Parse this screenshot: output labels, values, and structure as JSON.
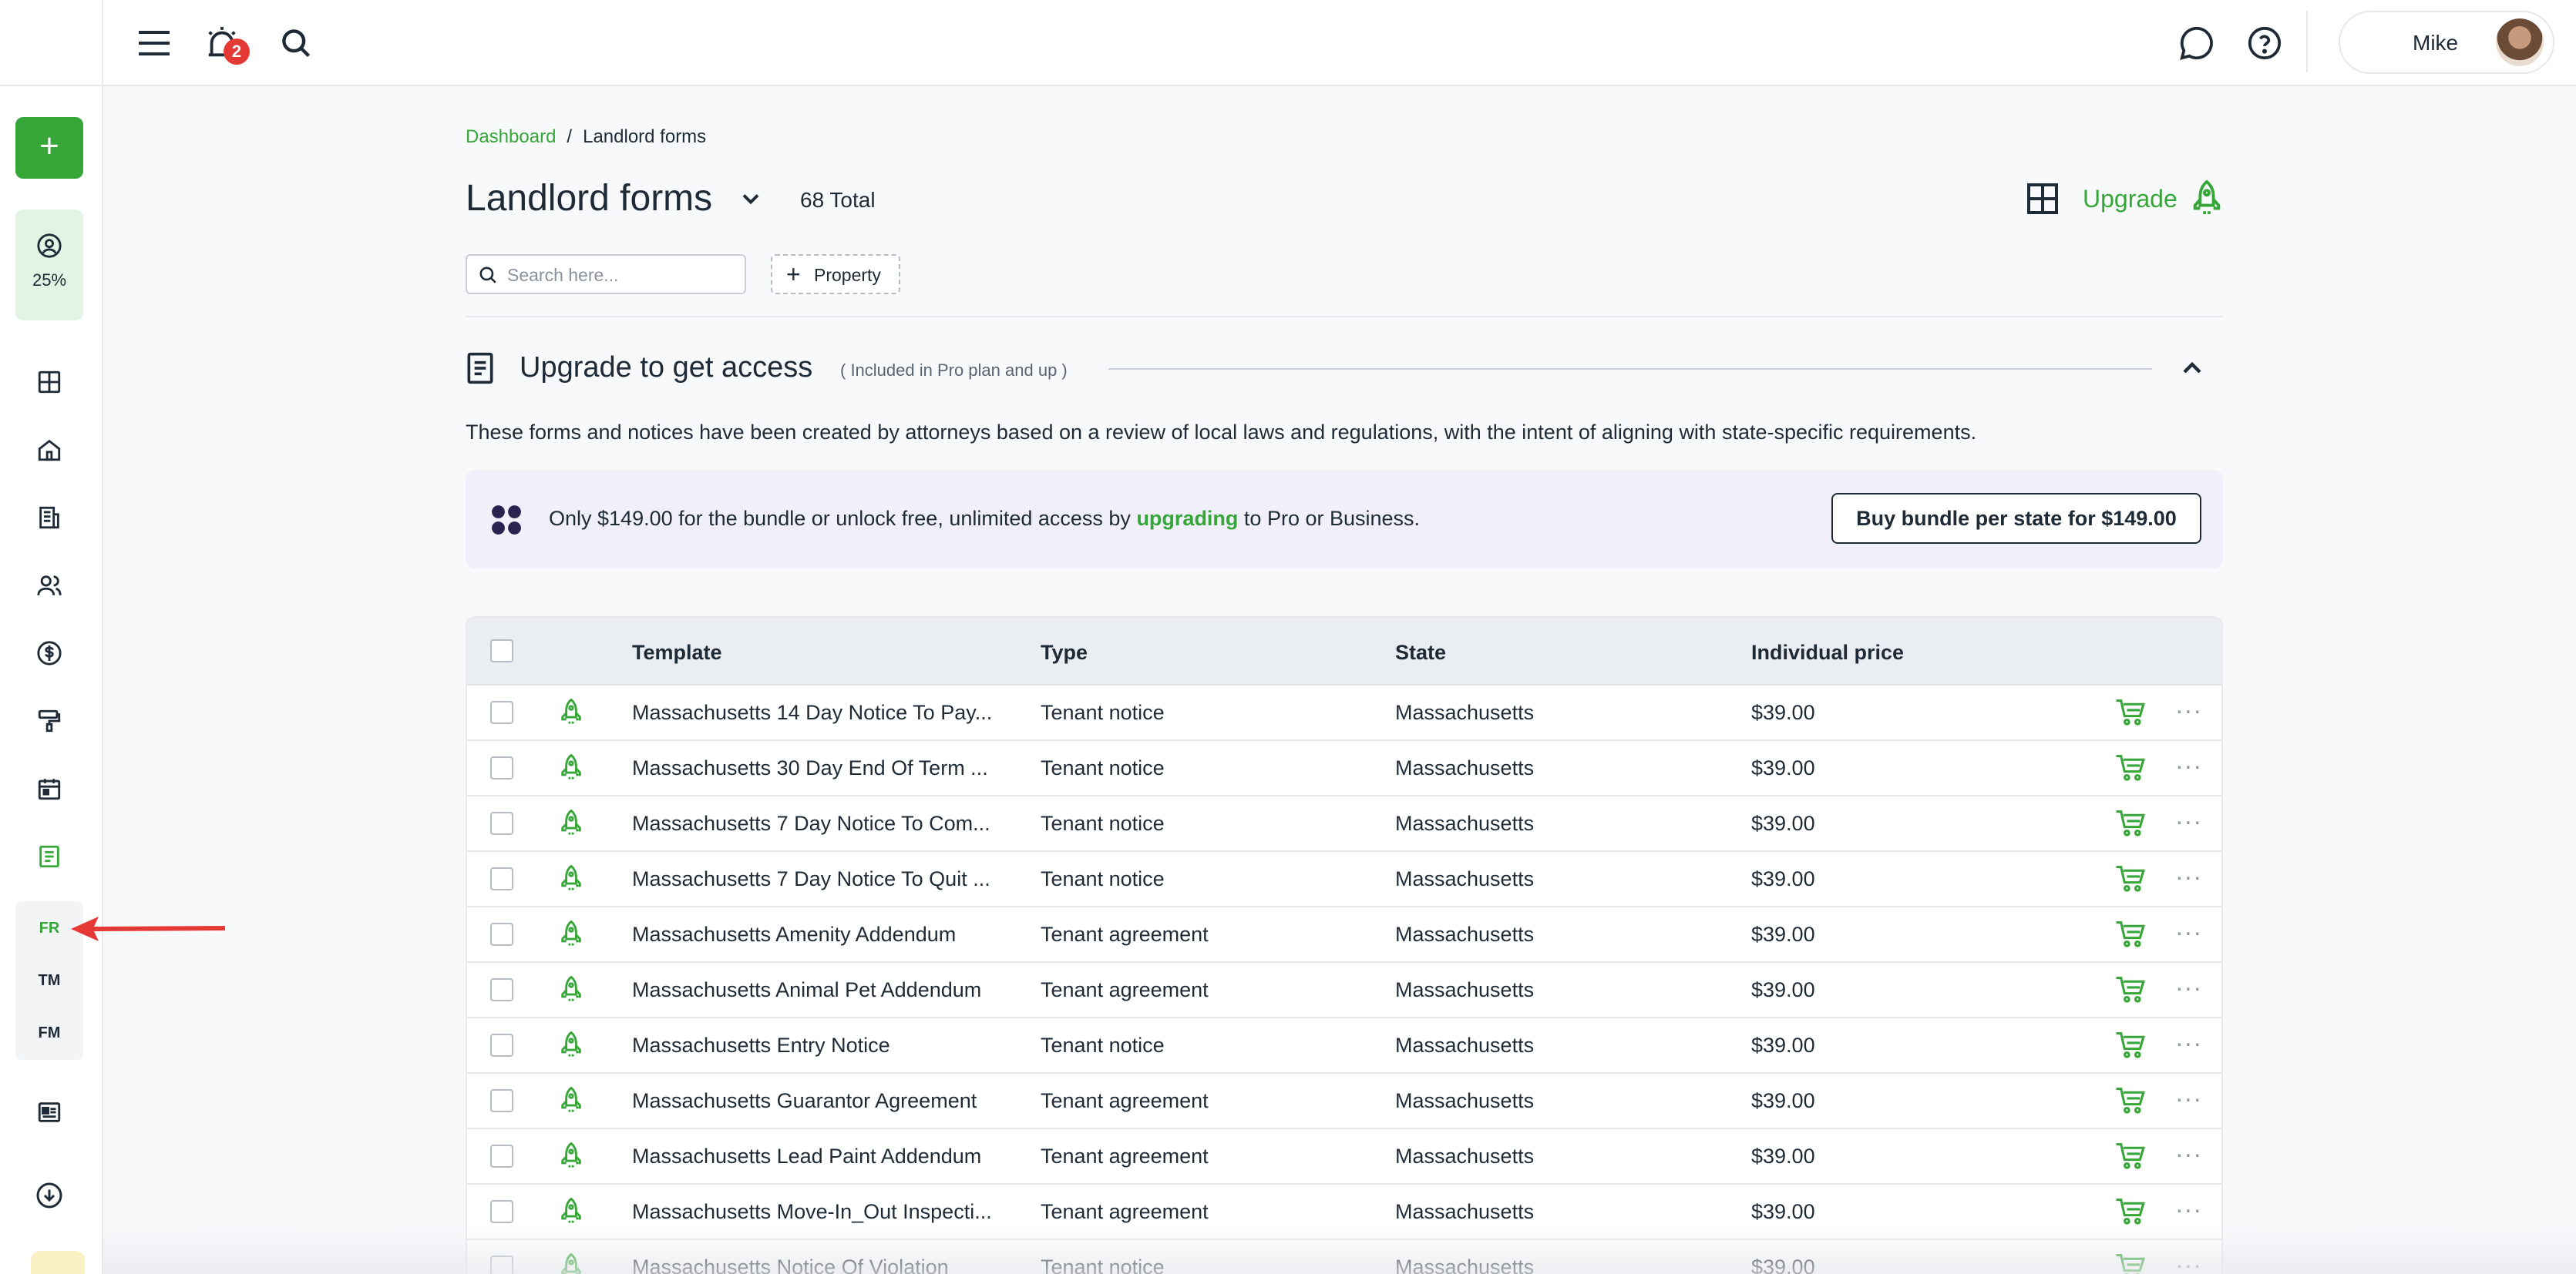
{
  "topbar": {
    "notifications_count": "2",
    "user_name": "Mike"
  },
  "sidebar": {
    "progress_pct": "25%",
    "sub_items": [
      "FR",
      "TM",
      "FM"
    ]
  },
  "breadcrumb": {
    "root": "Dashboard",
    "separator": "/",
    "current": "Landlord forms"
  },
  "header": {
    "title": "Landlord forms",
    "total": "68 Total",
    "upgrade_label": "Upgrade"
  },
  "filters": {
    "search_placeholder": "Search here...",
    "property_label": "Property"
  },
  "upgrade_section": {
    "title": "Upgrade to get access",
    "note": "( Included in Pro plan and up )",
    "description": "These forms and notices have been created by attorneys based on a review of local laws and regulations, with the intent of aligning with state-specific requirements.",
    "bundle_text_before": "Only $149.00 for the bundle or unlock free, unlimited access by ",
    "bundle_link": "upgrading",
    "bundle_text_after": " to Pro or Business.",
    "bundle_button": "Buy bundle per state for $149.00"
  },
  "table": {
    "columns": {
      "template": "Template",
      "type": "Type",
      "state": "State",
      "price": "Individual price"
    },
    "rows": [
      {
        "template": "Massachusetts 14 Day Notice To Pay...",
        "type": "Tenant notice",
        "state": "Massachusetts",
        "price": "$39.00"
      },
      {
        "template": "Massachusetts 30 Day End Of Term ...",
        "type": "Tenant notice",
        "state": "Massachusetts",
        "price": "$39.00"
      },
      {
        "template": "Massachusetts 7 Day Notice To Com...",
        "type": "Tenant notice",
        "state": "Massachusetts",
        "price": "$39.00"
      },
      {
        "template": "Massachusetts 7 Day Notice To Quit ...",
        "type": "Tenant notice",
        "state": "Massachusetts",
        "price": "$39.00"
      },
      {
        "template": "Massachusetts Amenity Addendum",
        "type": "Tenant agreement",
        "state": "Massachusetts",
        "price": "$39.00"
      },
      {
        "template": "Massachusetts Animal Pet Addendum",
        "type": "Tenant agreement",
        "state": "Massachusetts",
        "price": "$39.00"
      },
      {
        "template": "Massachusetts Entry Notice",
        "type": "Tenant notice",
        "state": "Massachusetts",
        "price": "$39.00"
      },
      {
        "template": "Massachusetts Guarantor Agreement",
        "type": "Tenant agreement",
        "state": "Massachusetts",
        "price": "$39.00"
      },
      {
        "template": "Massachusetts Lead Paint Addendum",
        "type": "Tenant agreement",
        "state": "Massachusetts",
        "price": "$39.00"
      },
      {
        "template": "Massachusetts Move-In_Out Inspecti...",
        "type": "Tenant agreement",
        "state": "Massachusetts",
        "price": "$39.00"
      },
      {
        "template": "Massachusetts Notice Of Violation",
        "type": "Tenant notice",
        "state": "Massachusetts",
        "price": "$39.00"
      }
    ]
  },
  "colors": {
    "accent": "#35a637",
    "text": "#1f2a37",
    "badge": "#e53935",
    "bundle_bg": "#f1eff9",
    "annotation_arrow": "#e53935"
  }
}
